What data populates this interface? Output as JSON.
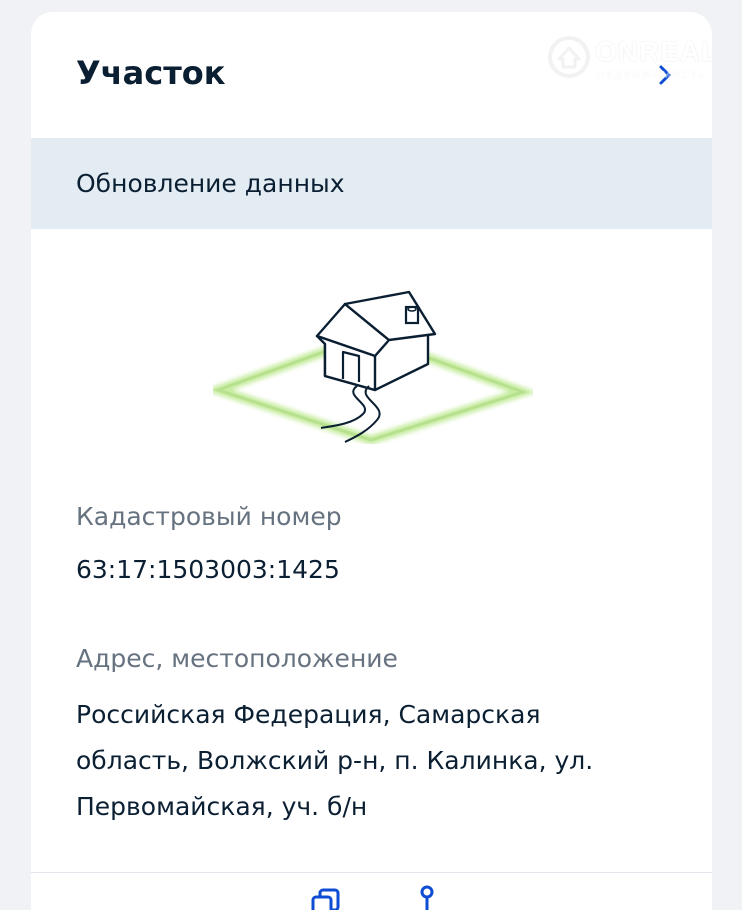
{
  "watermark": {
    "brand": "ONREALT",
    "tagline": "НЕДВИЖИМОСТЬ"
  },
  "header": {
    "title": "Участок",
    "open_icon": "chevron-right-icon"
  },
  "update_banner": {
    "label": "Обновление данных"
  },
  "illustration": {
    "icon": "house-on-plot-icon",
    "plot_color": "#b7e18e"
  },
  "cadastral": {
    "label": "Кадастровый номер",
    "value": "63:17:1503003:1425"
  },
  "address": {
    "label": "Адрес, местоположение",
    "lines": [
      "Российская Федерация, Самарская",
      "область, Волжский р-н, п. Калинка, ул.",
      "Первомайская, уч. б/н"
    ]
  },
  "bottom_actions": [
    {
      "icon": "copy-icon"
    },
    {
      "icon": "share-icon"
    }
  ],
  "colors": {
    "text": "#0b1f33",
    "muted": "#66727f",
    "band": "#e4ecf3",
    "accent": "#0d4cd3"
  }
}
